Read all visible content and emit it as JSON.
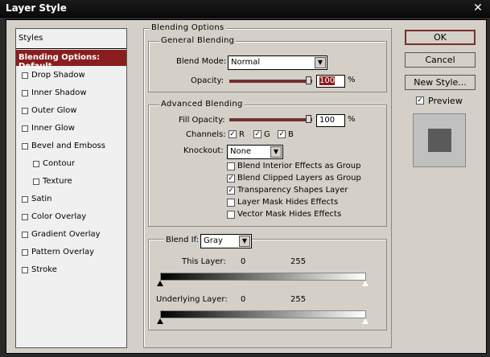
{
  "window": {
    "title": "Layer Style",
    "close_glyph": "✕"
  },
  "sidebar": {
    "header": "Styles",
    "items": [
      {
        "label": "Blending Options: Default",
        "selected": true,
        "checkbox": false
      },
      {
        "label": "Drop Shadow",
        "checked": false
      },
      {
        "label": "Inner Shadow",
        "checked": false
      },
      {
        "label": "Outer Glow",
        "checked": false
      },
      {
        "label": "Inner Glow",
        "checked": false
      },
      {
        "label": "Bevel and Emboss",
        "checked": false
      },
      {
        "label": "Contour",
        "checked": false,
        "indent": true
      },
      {
        "label": "Texture",
        "checked": false,
        "indent": true
      },
      {
        "label": "Satin",
        "checked": false
      },
      {
        "label": "Color Overlay",
        "checked": false
      },
      {
        "label": "Gradient Overlay",
        "checked": false
      },
      {
        "label": "Pattern Overlay",
        "checked": false
      },
      {
        "label": "Stroke",
        "checked": false
      }
    ]
  },
  "blending": {
    "section_title": "Blending Options",
    "general": {
      "title": "General Blending",
      "blend_mode_label": "Blend Mode:",
      "blend_mode_value": "Normal",
      "opacity_label": "Opacity:",
      "opacity_value": "100",
      "opacity_unit": "%"
    },
    "advanced": {
      "title": "Advanced Blending",
      "fill_opacity_label": "Fill Opacity:",
      "fill_opacity_value": "100",
      "fill_opacity_unit": "%",
      "channels_label": "Channels:",
      "channels": [
        {
          "label": "R",
          "checked": true
        },
        {
          "label": "G",
          "checked": true
        },
        {
          "label": "B",
          "checked": true
        }
      ],
      "knockout_label": "Knockout:",
      "knockout_value": "None",
      "options": [
        {
          "label": "Blend Interior Effects as Group",
          "checked": false
        },
        {
          "label": "Blend Clipped Layers as Group",
          "checked": true
        },
        {
          "label": "Transparency Shapes Layer",
          "checked": true
        },
        {
          "label": "Layer Mask Hides Effects",
          "checked": false
        },
        {
          "label": "Vector Mask Hides Effects",
          "checked": false
        }
      ]
    },
    "blend_if": {
      "label": "Blend If:",
      "value": "Gray",
      "this_layer_label": "This Layer:",
      "this_layer_min": "0",
      "this_layer_max": "255",
      "underlying_label": "Underlying Layer:",
      "underlying_min": "0",
      "underlying_max": "255"
    }
  },
  "buttons": {
    "ok": "OK",
    "cancel": "Cancel",
    "new_style": "New Style...",
    "preview_label": "Preview",
    "preview_checked": true
  },
  "colors": {
    "accent": "#8a1e1e",
    "dialog_bg": "#d4d0c8",
    "titlebar": "#0a0a0a"
  }
}
